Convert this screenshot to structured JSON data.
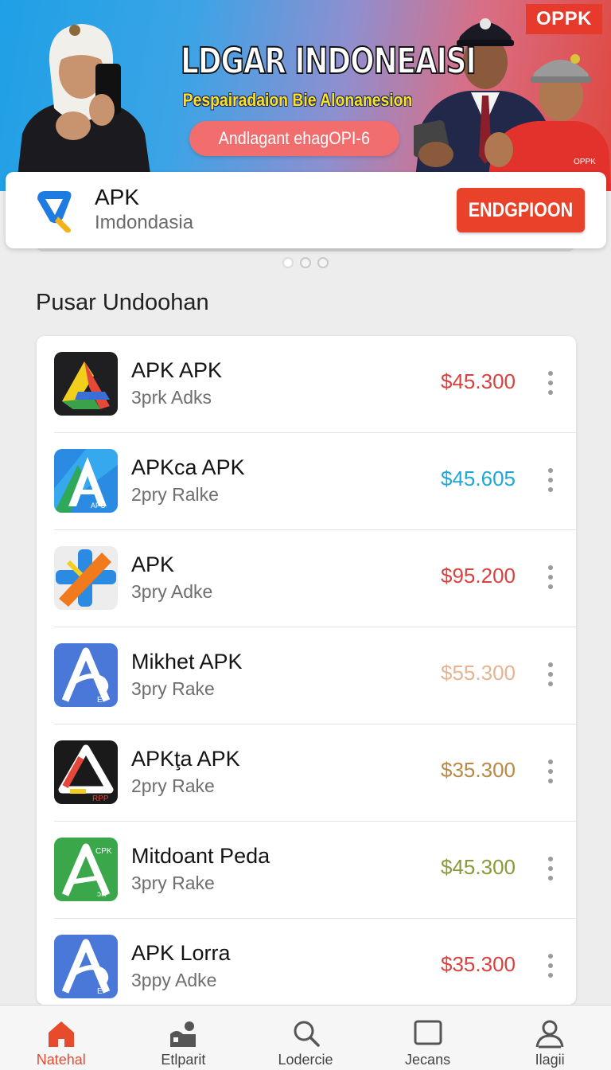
{
  "hero": {
    "title": "LDGAR INDONEAISI",
    "subtitle": "Pespairadaion Bie Alonanesion",
    "pill_text": "Andlagant ehagOPI-6",
    "badge": "OPPK"
  },
  "app_card": {
    "name": "APK",
    "subtitle": "Imdondasia",
    "install_label": "ENDGPIOON"
  },
  "carousel": {
    "pages": 3,
    "active_index": 0
  },
  "section": {
    "title": "Pusar Undoohan"
  },
  "apps": [
    {
      "name": "APK APK",
      "sub": "3prk Adks",
      "price": "$45.300",
      "price_color": "#d9413f",
      "icon": "triangle-logo-dark"
    },
    {
      "name": "APKca APK",
      "sub": "2pry Ralke",
      "price": "$45.605",
      "price_color": "#1ea8d8",
      "icon": "letter-a-blue-green"
    },
    {
      "name": "APK",
      "sub": "3pry Adke",
      "price": "$95.200",
      "price_color": "#d9413f",
      "icon": "cross-logo-orange-blue"
    },
    {
      "name": "Mikhet APK",
      "sub": "3pry Rake",
      "price": "$55.300",
      "price_color": "#e6b491",
      "icon": "letter-a-blue"
    },
    {
      "name": "APKţa APK",
      "sub": "2pry Rake",
      "price": "$35.300",
      "price_color": "#b98a45",
      "icon": "triangle-logo-black-red"
    },
    {
      "name": "Mitdoant Peda",
      "sub": "3pry Rake",
      "price": "$45.300",
      "price_color": "#8a9a3a",
      "icon": "letter-a-green"
    },
    {
      "name": "APK Lorra",
      "sub": "3ppy Adke",
      "price": "$35.300",
      "price_color": "#d9413f",
      "icon": "letter-a-blue"
    }
  ],
  "nav": [
    {
      "label": "Natehal",
      "icon": "home-icon",
      "active": true
    },
    {
      "label": "Etlparit",
      "icon": "store-icon",
      "active": false
    },
    {
      "label": "Lodercie",
      "icon": "search-icon",
      "active": false
    },
    {
      "label": "Jecans",
      "icon": "square-icon",
      "active": false
    },
    {
      "label": "Ilagii",
      "icon": "user-icon",
      "active": false
    }
  ],
  "colors": {
    "accent": "#e8432a",
    "hero_start": "#1fa0e6",
    "hero_end": "#e0473e"
  }
}
